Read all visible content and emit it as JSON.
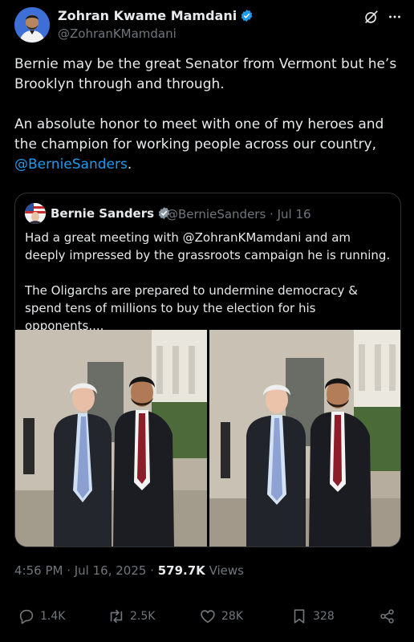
{
  "author": {
    "name": "Zohran Kwame Mamdani",
    "handle": "@ZohranKMamdani",
    "verified_color": "#1d9bf0"
  },
  "tweet": {
    "line1": "Bernie may be the great Senator from Vermont but he’s Brooklyn through and through.",
    "line2_prefix": "An absolute honor to meet with one of my heroes and the champion for working people across our country, ",
    "mention": "@BernieSanders",
    "line2_suffix": "."
  },
  "quoted": {
    "name": "Bernie Sanders",
    "handle_date": "@BernieSanders · Jul 16",
    "para1": "Had a great meeting with @ZohranKMamdani and am deeply impressed by the grassroots campaign he is running.",
    "para2": "The Oligarchs are prepared to undermine democracy & spend tens of millions to buy the election for his opponents...."
  },
  "meta": {
    "time_date": "4:56 PM · Jul 16, 2025 · ",
    "views_count": "579.7K",
    "views_label": " Views"
  },
  "actions": {
    "replies": "1.4K",
    "reposts": "2.5K",
    "likes": "28K",
    "bookmarks": "328"
  },
  "icons": [
    "grok-icon",
    "more-icon",
    "verified-badge-icon",
    "reply-icon",
    "repost-icon",
    "like-icon",
    "bookmark-icon",
    "share-icon"
  ]
}
